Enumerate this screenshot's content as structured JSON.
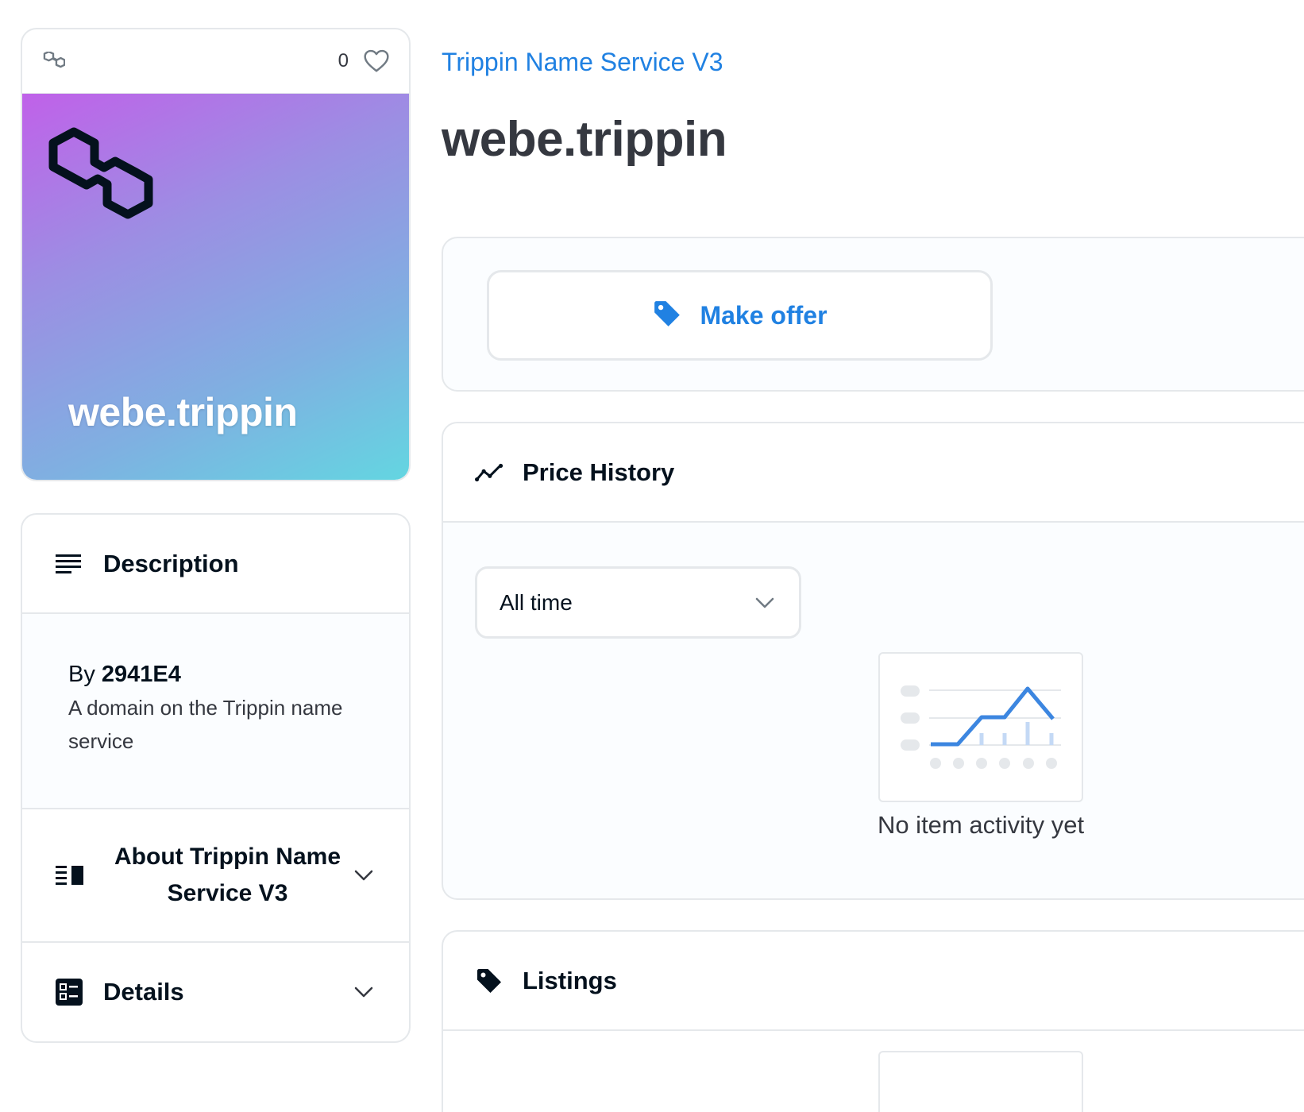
{
  "asset_card": {
    "favorites_count": "0",
    "art_name": "webe.trippin",
    "colors": {
      "gradient_start": "#c061e9",
      "gradient_end": "#63d6e1"
    },
    "chain_icon": "polygon-icon",
    "favorite_icon": "heart-icon"
  },
  "description_panel": {
    "title": "Description",
    "icon": "description-lines-icon",
    "by_prefix": "By",
    "creator": "2941E4",
    "text": "A domain on the Trippin name service"
  },
  "about_panel": {
    "title": "About Trippin Name Service V3",
    "icon": "about-collection-icon"
  },
  "details_panel": {
    "title": "Details",
    "icon": "details-grid-icon"
  },
  "header": {
    "collection_name": "Trippin Name Service V3",
    "item_name": "webe.trippin"
  },
  "offer_panel": {
    "button_label": "Make offer",
    "icon": "tag-icon"
  },
  "price_history": {
    "title": "Price History",
    "icon": "trend-line-icon",
    "time_range": "All time",
    "empty_message": "No item activity yet"
  },
  "listings": {
    "title": "Listings",
    "icon": "tag-icon"
  },
  "theme": {
    "accent": "#2081e2",
    "border": "#e5e8eb",
    "text_dark": "#04111d",
    "text_muted": "#353840"
  }
}
